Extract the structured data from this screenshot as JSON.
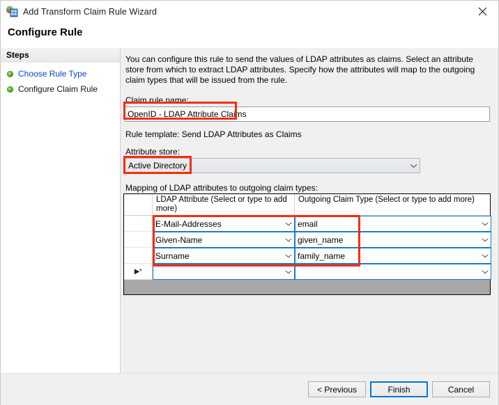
{
  "window": {
    "title": "Add Transform Claim Rule Wizard",
    "icon": "adfs-wizard-icon",
    "close_label": "Close"
  },
  "header": {
    "page_title": "Configure Rule"
  },
  "sidebar": {
    "title": "Steps",
    "items": [
      {
        "label": "Choose Rule Type",
        "state": "link"
      },
      {
        "label": "Configure Claim Rule",
        "state": "current"
      }
    ]
  },
  "main": {
    "description": "You can configure this rule to send the values of LDAP attributes as claims. Select an attribute store from which to extract LDAP attributes. Specify how the attributes will map to the outgoing claim types that will be issued from the rule.",
    "rule_name_label": "Claim rule name:",
    "rule_name_value": "OpenID - LDAP Attribute Claims",
    "rule_name_placeholder": "",
    "rule_template_text": "Rule template: Send LDAP Attributes as Claims",
    "attribute_store_label": "Attribute store:",
    "attribute_store_value": "Active Directory",
    "mapping_label": "Mapping of LDAP attributes to outgoing claim types:"
  },
  "grid": {
    "columns": [
      "LDAP Attribute (Select or type to add more)",
      "Outgoing Claim Type (Select or type to add more)"
    ],
    "rows": [
      {
        "ldap_attribute": "E-Mail-Addresses",
        "outgoing_claim_type": "email"
      },
      {
        "ldap_attribute": "Given-Name",
        "outgoing_claim_type": "given_name"
      },
      {
        "ldap_attribute": "Surname",
        "outgoing_claim_type": "family_name"
      },
      {
        "ldap_attribute": "",
        "outgoing_claim_type": ""
      }
    ],
    "new_row_marker": "▶*"
  },
  "footer": {
    "previous_label": "< Previous",
    "finish_label": "Finish",
    "cancel_label": "Cancel"
  },
  "colors": {
    "annotation": "#fc2b09",
    "focus_border": "#0078d7",
    "cell_border": "#1a7cc7",
    "link": "#0645c8",
    "dialog_bg": "#f0f0f0",
    "grid_filler": "#a8a8a8"
  }
}
